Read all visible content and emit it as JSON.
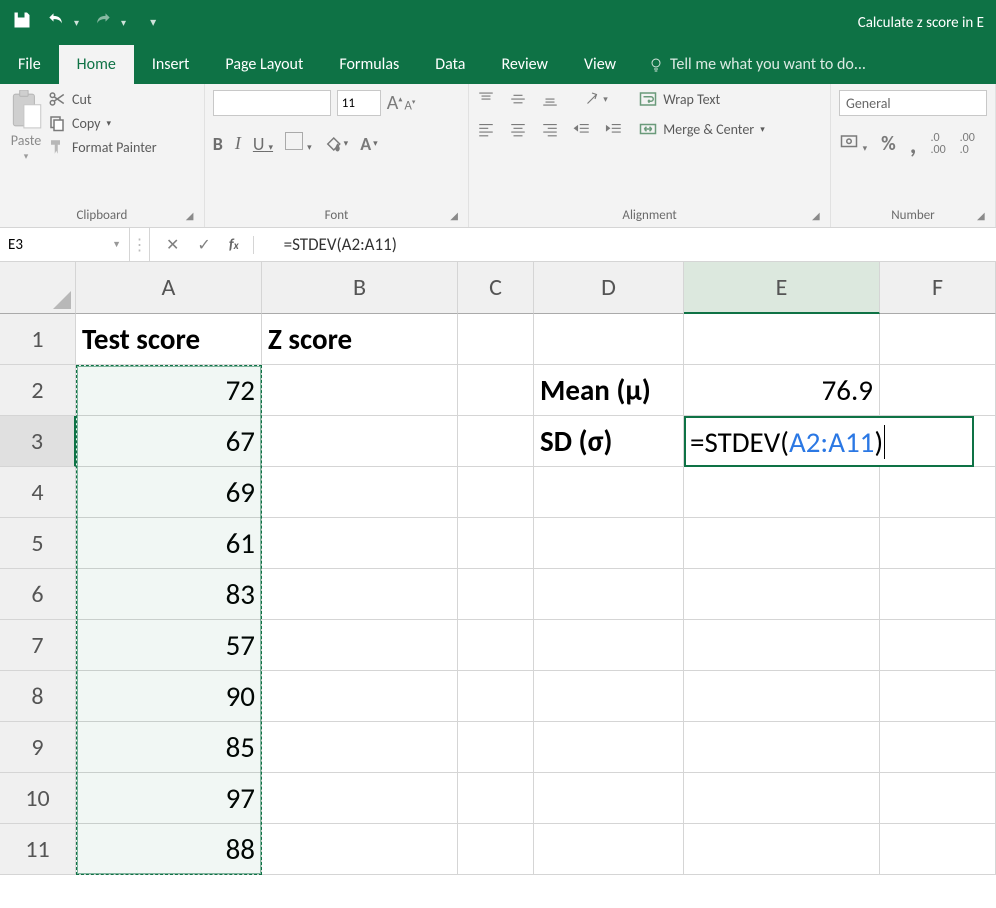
{
  "titlebar": {
    "title": "Calculate z score in E"
  },
  "tabs": {
    "file": "File",
    "home": "Home",
    "insert": "Insert",
    "pagelayout": "Page Layout",
    "formulas": "Formulas",
    "data": "Data",
    "review": "Review",
    "view": "View",
    "tell": "Tell me what you want to do..."
  },
  "ribbon": {
    "clipboard": {
      "title": "Clipboard",
      "paste": "Paste",
      "cut": "Cut",
      "copy": "Copy",
      "fmtpainter": "Format Painter"
    },
    "font": {
      "title": "Font",
      "name": "",
      "size": "11",
      "bold": "B",
      "italic": "I",
      "underline": "U"
    },
    "alignment": {
      "title": "Alignment",
      "wrap": "Wrap Text",
      "merge": "Merge & Center"
    },
    "number": {
      "title": "Number",
      "format": "General",
      "pct": "%",
      "comma": ",",
      "dec0": ".0",
      "dec00": ".00"
    }
  },
  "namebox": "E3",
  "formula": "=STDEV(A2:A11)",
  "edit": {
    "prefix": "=STDEV(",
    "ref": "A2:A11",
    "suffix": ")"
  },
  "columns": [
    "A",
    "B",
    "C",
    "D",
    "E",
    "F"
  ],
  "rows": [
    "1",
    "2",
    "3",
    "4",
    "5",
    "6",
    "7",
    "8",
    "9",
    "10",
    "11"
  ],
  "cells": {
    "A1": "Test score",
    "B1": "Z score",
    "A2": "72",
    "A3": "67",
    "A4": "69",
    "A5": "61",
    "A6": "83",
    "A7": "57",
    "A8": "90",
    "A9": "85",
    "A10": "97",
    "A11": "88",
    "D2": "Mean (μ)",
    "E2": "76.9",
    "D3": "SD (σ)"
  }
}
